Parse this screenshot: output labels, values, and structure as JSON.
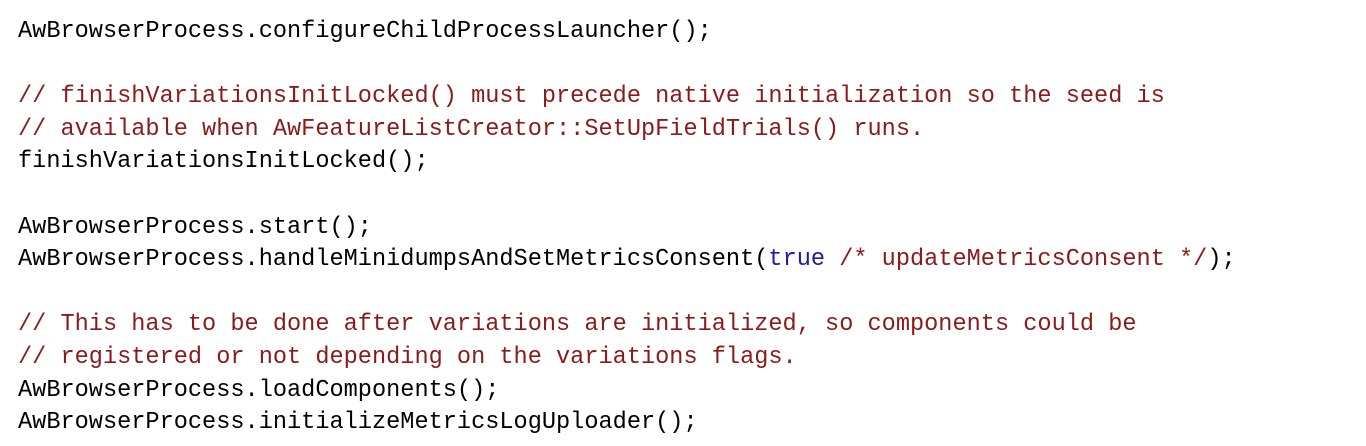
{
  "colors": {
    "default_text": "#000000",
    "comment": "#8b1a1a",
    "keyword": "#1c1ca8",
    "background": "#ffffff"
  },
  "code": {
    "line1": "AwBrowserProcess.configureChildProcessLauncher();",
    "comment1a": "// finishVariationsInitLocked() must precede native initialization so the seed is",
    "comment1b": "// available when AwFeatureListCreator::SetUpFieldTrials() runs.",
    "line2": "finishVariationsInitLocked();",
    "line3": "AwBrowserProcess.start();",
    "line4_prefix": "AwBrowserProcess.handleMinidumpsAndSetMetricsConsent(",
    "line4_keyword": "true",
    "line4_comment": " /* updateMetricsConsent */",
    "line4_suffix": ");",
    "comment2a": "// This has to be done after variations are initialized, so components could be",
    "comment2b": "// registered or not depending on the variations flags.",
    "line5": "AwBrowserProcess.loadComponents();",
    "line6": "AwBrowserProcess.initializeMetricsLogUploader();"
  }
}
